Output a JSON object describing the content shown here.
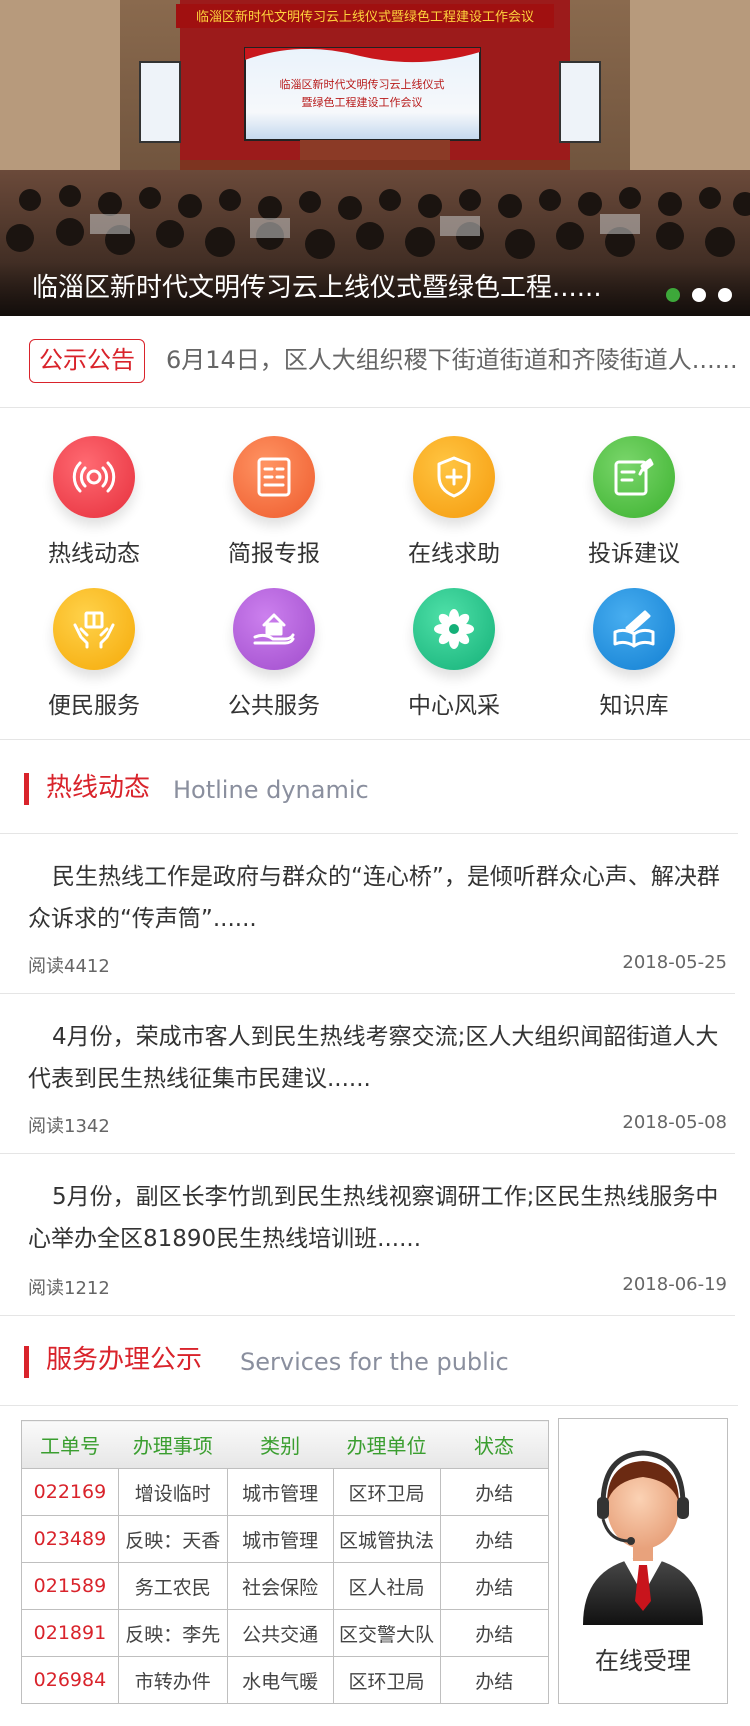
{
  "banner": {
    "caption": "临淄区新时代文明传习云上线仪式暨绿色工程......",
    "stage_banner": "临淄区新时代文明传习云上线仪式暨绿色工程建设工作会议",
    "screen_line1": "临淄区新时代文明传习云上线仪式",
    "screen_line2": "暨绿色工程建设工作会议",
    "slide_count": 3,
    "active_slide": 1
  },
  "notice": {
    "badge": "公示公告",
    "text": "6月14日，区人大组织稷下街道街道和齐陵街道人......"
  },
  "services": [
    {
      "label": "热线动态",
      "icon": "broadcast-icon",
      "color": "#f0434f"
    },
    {
      "label": "简报专报",
      "icon": "document-icon",
      "color": "#f26b3a"
    },
    {
      "label": "在线求助",
      "icon": "shield-plus-icon",
      "color": "#f7a11d"
    },
    {
      "label": "投诉建议",
      "icon": "edit-note-icon",
      "color": "#4cbf3f"
    },
    {
      "label": "便民服务",
      "icon": "gift-hands-icon",
      "color": "#f9b81b"
    },
    {
      "label": "公共服务",
      "icon": "house-hand-icon",
      "color": "#b05ad6"
    },
    {
      "label": "中心风采",
      "icon": "flower-icon",
      "color": "#1fc38a"
    },
    {
      "label": "知识库",
      "icon": "book-pen-icon",
      "color": "#1a8ee0"
    }
  ],
  "hotline": {
    "title": "热线动态",
    "title_en": "Hotline dynamic",
    "news": [
      {
        "text": "民生热线工作是政府与群众的“连心桥”，是倾听群众心声、解决群众诉求的“传声筒”......",
        "reads": "阅读4412",
        "date": "2018-05-25"
      },
      {
        "text": "4月份，荣成市客人到民生热线考察交流;区人大组织闻韶街道人大代表到民生热线征集市民建议......",
        "reads": "阅读1342",
        "date": "2018-05-08"
      },
      {
        "text": "5月份，副区长李竹凯到民生热线视察调研工作;区民生热线服务中心举办全区81890民生热线培训班......",
        "reads": "阅读1212",
        "date": "2018-06-19"
      }
    ]
  },
  "public_services": {
    "title": "服务办理公示",
    "title_en": "Services for the public",
    "headers": [
      "工单号",
      "办理事项",
      "类别",
      "办理单位",
      "状态"
    ],
    "rows": [
      [
        "022169",
        "增设临时",
        "城市管理",
        "区环卫局",
        "办结"
      ],
      [
        "023489",
        "反映：天香",
        "城市管理",
        "区城管执法",
        "办结"
      ],
      [
        "021589",
        "务工农民",
        "社会保险",
        "区人社局",
        "办结"
      ],
      [
        "021891",
        "反映：李先",
        "公共交通",
        "区交警大队",
        "办结"
      ],
      [
        "026984",
        "市转办件",
        "水电气暖",
        "区环卫局",
        "办结"
      ]
    ],
    "online_label": "在线受理"
  }
}
